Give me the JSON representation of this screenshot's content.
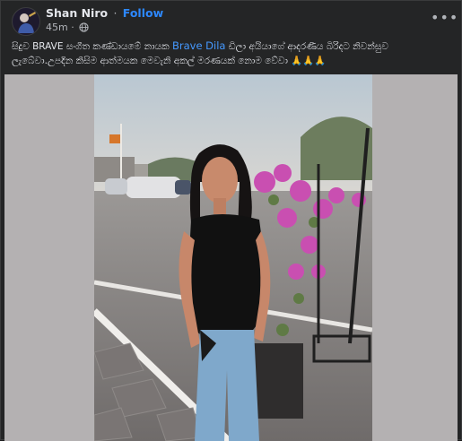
{
  "post": {
    "author": "Shan Niro",
    "follow_label": "Follow",
    "separator": "·",
    "time": "45m",
    "more_label": "•••",
    "caption": {
      "part1": "සිදුව BRAVE සංගීත කණ්ඩායමේ නායක ",
      "mention": "Brave Dila",
      "part2": " ඩිලා අයියාගේ ආදරණීය බිරිදට නිවන්සුව ලැබේවා.උපදින කිසිම ආත්මයක මෙවැනි අකල් මරණයක් නොම වේවා ",
      "emoji": "🙏🙏🙏"
    }
  },
  "icons": {
    "globe": "globe-icon",
    "more": "more-options-icon",
    "avatar": "profile-avatar"
  },
  "colors": {
    "background": "#242526",
    "text": "#e4e6eb",
    "secondary_text": "#b0b3b8",
    "link": "#2d88ff",
    "media_backdrop": "#b4b1b2"
  }
}
